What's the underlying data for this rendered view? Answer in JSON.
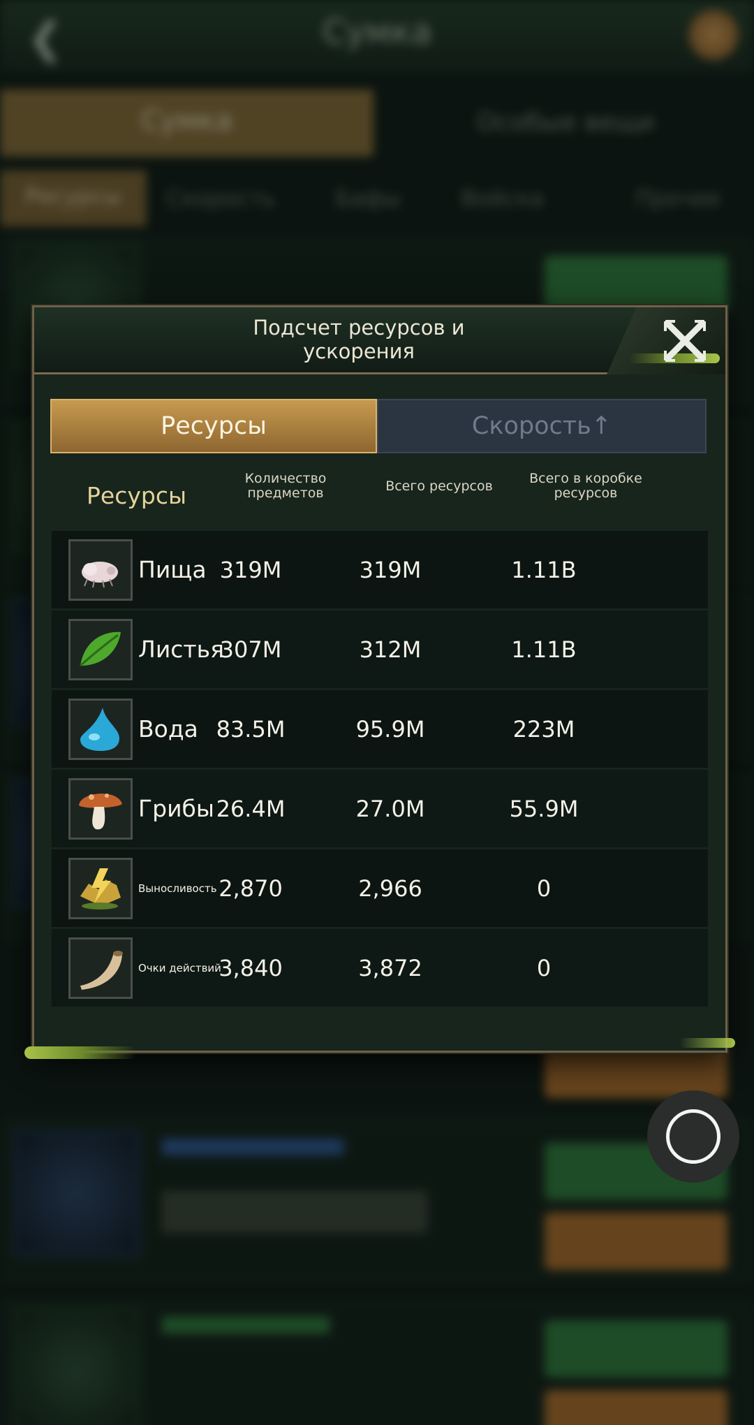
{
  "background": {
    "header_title": "Сумка",
    "back_icon": "back-arrow-icon",
    "tabs": [
      "Сумка",
      "Особые вещи"
    ],
    "subtabs": [
      "Ресурсы",
      "Скорость",
      "Бафы",
      "Войска",
      "Прочее"
    ]
  },
  "dialog": {
    "title": "Подсчет ресурсов и ускорения",
    "close_icon": "close-icon",
    "tabs": {
      "resources": "Ресурсы",
      "speed": "Скорость↑"
    },
    "columns": {
      "resource": "Ресурсы",
      "item_count": "Количество предметов",
      "total": "Всего ресурсов",
      "total_in_box": "Всего в коробке ресурсов"
    },
    "rows": [
      {
        "name": "Пища",
        "icon": "food-icon",
        "count": "319M",
        "total": "319M",
        "box": "1.11B"
      },
      {
        "name": "Листья",
        "icon": "leaf-icon",
        "count": "307M",
        "total": "312M",
        "box": "1.11B"
      },
      {
        "name": "Вода",
        "icon": "water-drop-icon",
        "count": "83.5M",
        "total": "95.9M",
        "box": "223M"
      },
      {
        "name": "Грибы",
        "icon": "mushroom-icon",
        "count": "26.4M",
        "total": "27.0M",
        "box": "55.9M"
      },
      {
        "name": "Выносливость",
        "icon": "stamina-icon",
        "count": "2,870",
        "total": "2,966",
        "box": "0"
      },
      {
        "name": "Очки действий",
        "icon": "horn-icon",
        "count": "3,840",
        "total": "3,872",
        "box": "0"
      }
    ]
  },
  "colors": {
    "accent_gold": "#c79a4f",
    "panel": "#17251d",
    "text": "#f4f1e8"
  }
}
